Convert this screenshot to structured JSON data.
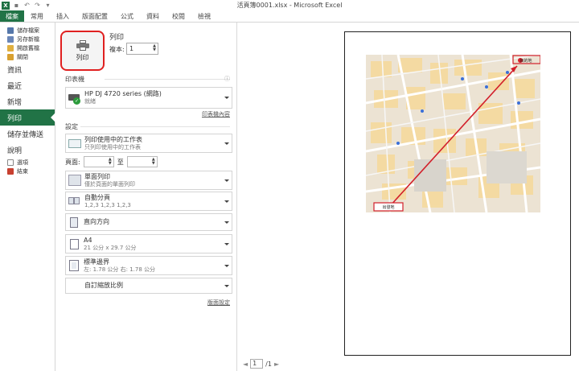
{
  "window": {
    "title": "活頁簿0001.xlsx - Microsoft Excel"
  },
  "qat": {
    "app_icon": "X"
  },
  "ribbon": {
    "tabs": [
      "檔案",
      "常用",
      "插入",
      "版面配置",
      "公式",
      "資料",
      "校閱",
      "檢視"
    ]
  },
  "nav": {
    "top_items": [
      "儲存檔案",
      "另存新檔",
      "開啟舊檔",
      "關閉"
    ],
    "big_items": [
      "資訊",
      "最近",
      "新增",
      "列印",
      "儲存並傳送",
      "說明"
    ],
    "bottom_items": [
      "選項",
      "結束"
    ]
  },
  "print": {
    "title": "列印",
    "button_label": "列印",
    "copies_label": "複本:",
    "copies_value": "1",
    "printer_section": "印表機",
    "printer_name": "HP DJ 4720 series (網路)",
    "printer_status": "就緒",
    "printer_properties_link": "印表機內容",
    "settings_section": "設定",
    "what_title": "列印使用中的工作表",
    "what_sub": "只列印使用中的工作表",
    "pages_label": "頁面:",
    "pages_to": "至",
    "sided_title": "單面列印",
    "sided_sub": "僅於頁面的單面列印",
    "collate_title": "自動分頁",
    "collate_sub": "1,2,3    1,2,3    1,2,3",
    "orientation": "直向方向",
    "paper_title": "A4",
    "paper_sub": "21 公分 x 29.7 公分",
    "margins_title": "標準邊界",
    "margins_sub": "左: 1.78 公分    右: 1.78 公分",
    "scaling": "自訂縮放比例",
    "page_setup_link": "版面設定"
  },
  "preview": {
    "current_page": "1",
    "total_pages": "/1",
    "map_label_top": "目的地",
    "map_label_bottom": "出發地"
  }
}
